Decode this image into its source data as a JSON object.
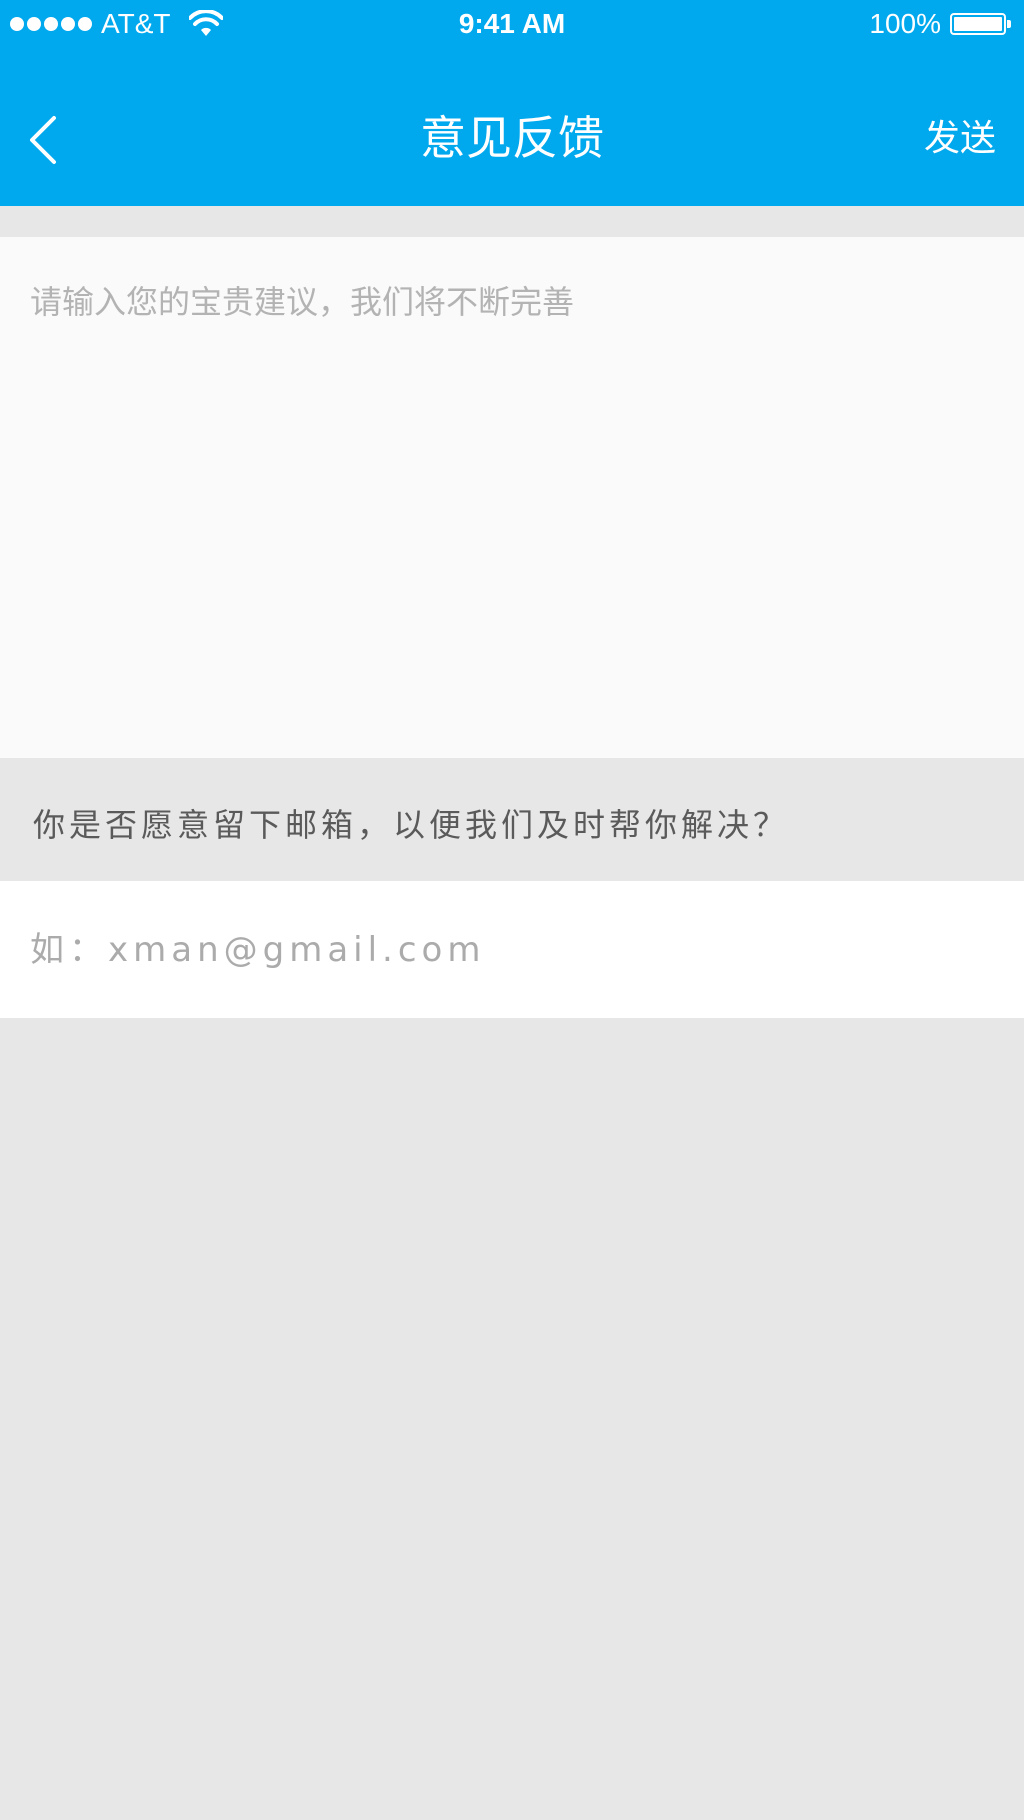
{
  "status_bar": {
    "carrier": "AT&T",
    "time": "9:41 AM",
    "battery_percent": "100%",
    "signal_bars": 5,
    "battery_level": 1.0,
    "icons": [
      "signal-icon",
      "wifi-icon",
      "battery-icon"
    ]
  },
  "nav": {
    "title": "意见反馈",
    "send_label": "发送",
    "back_icon": "chevron-left-icon"
  },
  "feedback": {
    "placeholder": "请输入您的宝贵建议，我们将不断完善",
    "value": ""
  },
  "email": {
    "prompt": "你是否愿意留下邮箱，以便我们及时帮你解决？",
    "placeholder": "如：xman@gmail.com",
    "value": ""
  },
  "colors": {
    "accent": "#00a8ee",
    "background": "#e7e7e7",
    "input_background": "#fafafa"
  }
}
